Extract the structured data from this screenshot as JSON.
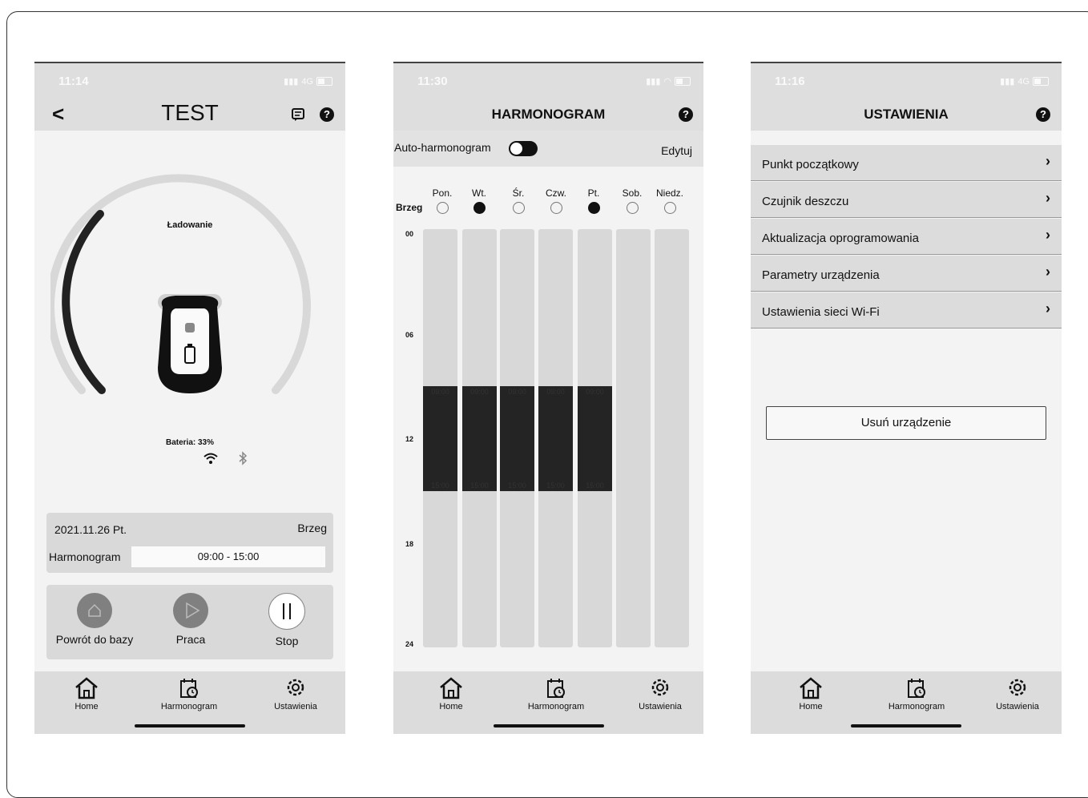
{
  "screen1": {
    "time": "11:14",
    "network": "4G",
    "title": "TEST",
    "back_label": "<",
    "help_label": "?",
    "status": "Ładowanie",
    "battery": "Bateria: 33%",
    "date": "2021.11.26 Pt.",
    "zone": "Brzeg",
    "schedule_label": "Harmonogram",
    "schedule_value": "09:00 - 15:00",
    "controls": {
      "home": "Powrót do bazy",
      "work": "Praca",
      "stop": "Stop"
    }
  },
  "screen2": {
    "time": "11:30",
    "title": "HARMONOGRAM",
    "help_label": "?",
    "auto_label": "Auto-harmonogram",
    "edit_label": "Edytuj",
    "zone": "Brzeg",
    "days": [
      {
        "name": "Pon.",
        "selected": false
      },
      {
        "name": "Wt.",
        "selected": true
      },
      {
        "name": "Śr.",
        "selected": false
      },
      {
        "name": "Czw.",
        "selected": false
      },
      {
        "name": "Pt.",
        "selected": true
      },
      {
        "name": "Sob.",
        "selected": false
      },
      {
        "name": "Niedz.",
        "selected": false
      }
    ],
    "hours": [
      "00",
      "06",
      "12",
      "18",
      "24"
    ],
    "blocks": [
      {
        "start": "09:00",
        "end": "15:00"
      },
      {
        "start": "09:00",
        "end": "15:00"
      },
      {
        "start": "09:00",
        "end": "15:00"
      },
      {
        "start": "09:00",
        "end": "15:00"
      },
      {
        "start": "09:00",
        "end": "15:00"
      }
    ]
  },
  "screen3": {
    "time": "11:16",
    "network": "4G",
    "title": "USTAWIENIA",
    "help_label": "?",
    "menu": [
      "Punkt początkowy",
      "Czujnik deszczu",
      "Aktualizacja oprogramowania",
      "Parametry urządzenia",
      "Ustawienia sieci Wi-Fi"
    ],
    "delete_label": "Usuń urządzenie"
  },
  "tabs": {
    "home": "Home",
    "schedule": "Harmonogram",
    "settings": "Ustawienia"
  }
}
